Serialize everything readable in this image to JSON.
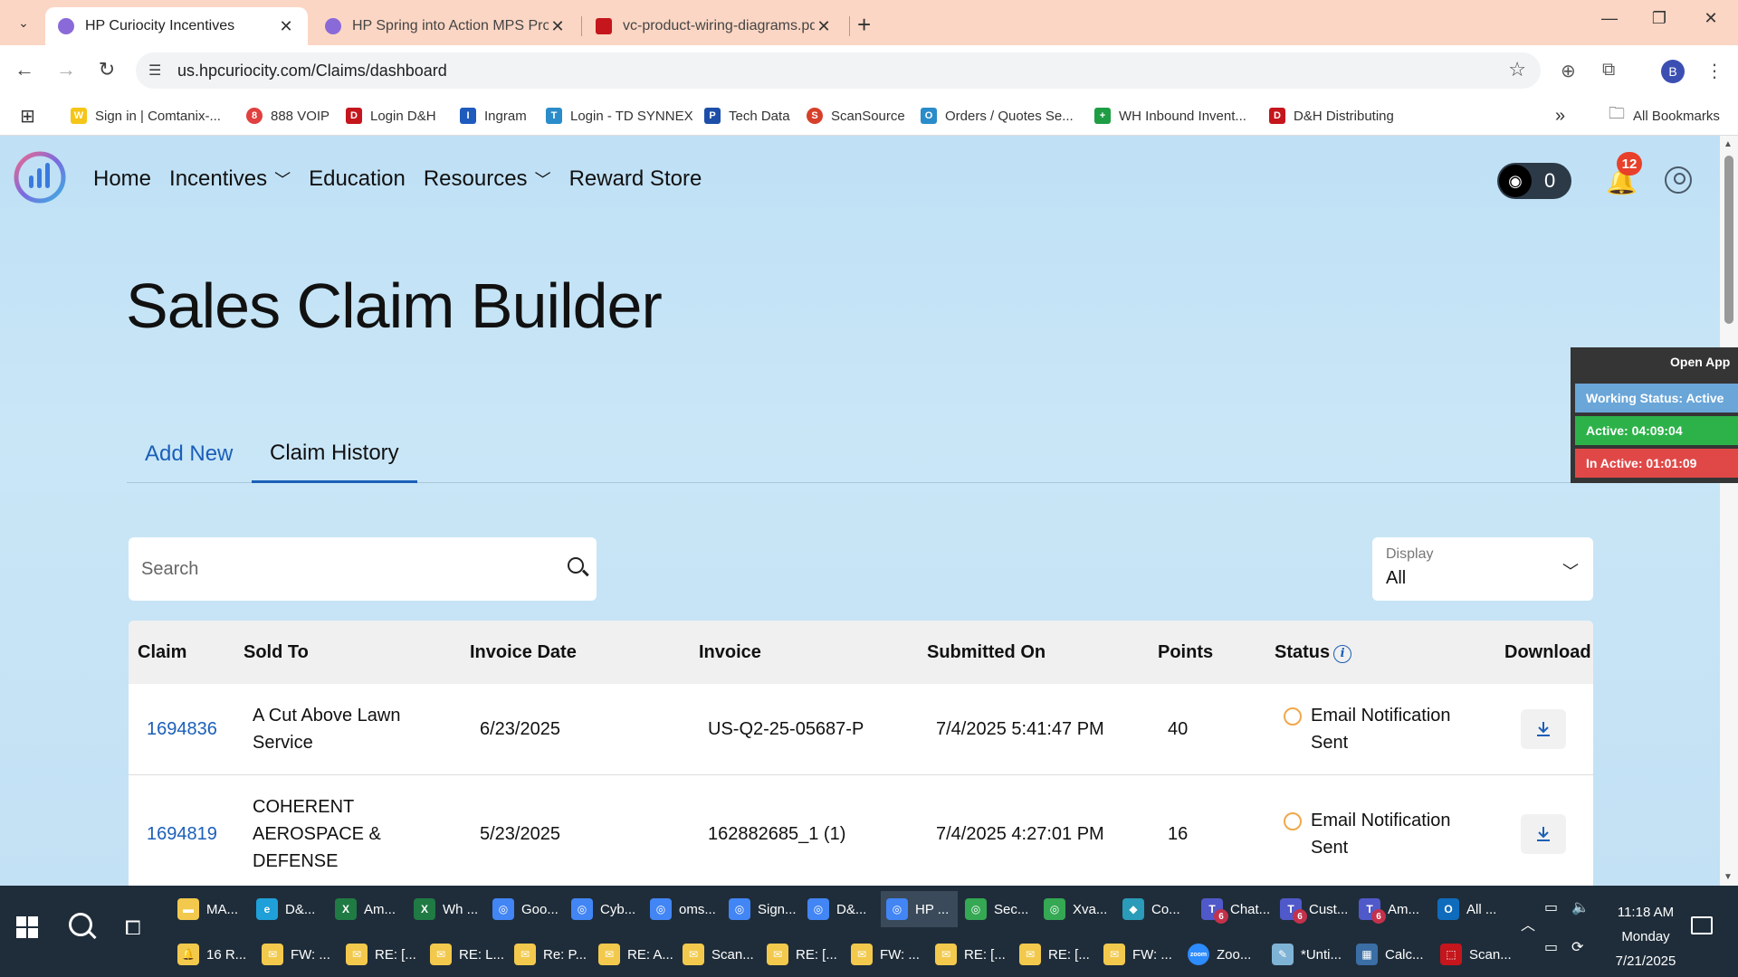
{
  "browser": {
    "tabs": [
      {
        "title": "HP Curiocity Incentives",
        "active": true,
        "favicon_color": "#8a6ad8"
      },
      {
        "title": "HP Spring into Action MPS Pro",
        "active": false,
        "favicon_color": "#8a6ad8"
      },
      {
        "title": "vc-product-wiring-diagrams.pd",
        "active": false,
        "favicon_color": "#c4161c"
      }
    ],
    "url": "us.hpcuriocity.com/Claims/dashboard",
    "profile_initial": "B"
  },
  "bookmarks": [
    {
      "label": "Sign in | Comtanix-...",
      "icon_color": "#f5c518",
      "icon_text": "W"
    },
    {
      "label": "888 VOIP",
      "icon_color": "#e04040",
      "icon_text": "8"
    },
    {
      "label": "Login D&H",
      "icon_color": "#c4161c",
      "icon_text": "D"
    },
    {
      "label": "Ingram",
      "icon_color": "#1e5bbd",
      "icon_text": "I"
    },
    {
      "label": "Login - TD SYNNEX",
      "icon_color": "#2a8cc9",
      "icon_text": "T"
    },
    {
      "label": "Tech Data",
      "icon_color": "#1d4fa8",
      "icon_text": "P"
    },
    {
      "label": "ScanSource",
      "icon_color": "#d6402a",
      "icon_text": "S"
    },
    {
      "label": "Orders / Quotes Se...",
      "icon_color": "#2a8cc9",
      "icon_text": "O"
    },
    {
      "label": "WH Inbound Invent...",
      "icon_color": "#1f9d44",
      "icon_text": "+"
    },
    {
      "label": "D&H Distributing",
      "icon_color": "#c4161c",
      "icon_text": "D"
    }
  ],
  "bookmarks_all": "All Bookmarks",
  "nav": {
    "items": [
      "Home",
      "Incentives",
      "Education",
      "Resources",
      "Reward Store"
    ],
    "points": "0",
    "notifications": "12"
  },
  "page": {
    "title": "Sales Claim Builder",
    "tabs": [
      "Add New",
      "Claim History"
    ],
    "active_tab": "Claim History"
  },
  "search": {
    "placeholder": "Search"
  },
  "display": {
    "label": "Display",
    "value": "All"
  },
  "table": {
    "headers": [
      "Claim",
      "Sold To",
      "Invoice Date",
      "Invoice",
      "Submitted On",
      "Points",
      "Status",
      "Download"
    ],
    "rows": [
      {
        "claim": "1694836",
        "sold_to_lines": [
          "A Cut Above Lawn",
          "Service"
        ],
        "invoice_date": "6/23/2025",
        "invoice": "US-Q2-25-05687-P",
        "submitted_on": "7/4/2025 5:41:47 PM",
        "points": "40",
        "status_lines": [
          "Email Notification",
          "Sent"
        ]
      },
      {
        "claim": "1694819",
        "sold_to_lines": [
          "COHERENT",
          "AEROSPACE &",
          "DEFENSE"
        ],
        "invoice_date": "5/23/2025",
        "invoice": "162882685_1 (1)",
        "submitted_on": "7/4/2025 4:27:01 PM",
        "points": "16",
        "status_lines": [
          "Email Notification",
          "Sent"
        ]
      }
    ]
  },
  "work_widget": {
    "open_app": "Open App",
    "status": "Working Status: Active",
    "active": "Active: 04:09:04",
    "inactive": "In Active: 01:01:09"
  },
  "taskbar": {
    "row1": [
      {
        "label": "MA...",
        "icon": "folder",
        "color": "#f2c94c"
      },
      {
        "label": "D&...",
        "icon": "edge",
        "color": "#1fa0d8"
      },
      {
        "label": "Am...",
        "icon": "excel",
        "color": "#1f7a44"
      },
      {
        "label": "Wh ...",
        "icon": "excel",
        "color": "#1f7a44"
      },
      {
        "label": "Goo...",
        "icon": "chrome",
        "color": "#4285f4"
      },
      {
        "label": "Cyb...",
        "icon": "chrome",
        "color": "#4285f4"
      },
      {
        "label": "oms...",
        "icon": "chrome",
        "color": "#4285f4"
      },
      {
        "label": "Sign...",
        "icon": "chrome",
        "color": "#4285f4"
      },
      {
        "label": "D&...",
        "icon": "chrome",
        "color": "#4285f4"
      },
      {
        "label": "HP ...",
        "icon": "chrome",
        "color": "#4285f4"
      },
      {
        "label": "Sec...",
        "icon": "chrome",
        "color": "#34a853"
      },
      {
        "label": "Xva...",
        "icon": "chrome",
        "color": "#34a853"
      },
      {
        "label": "Co...",
        "icon": "app",
        "color": "#2a9bb8"
      },
      {
        "label": "Chat...",
        "icon": "teams",
        "color": "#5059c9",
        "badge": "6"
      },
      {
        "label": "Cust...",
        "icon": "teams",
        "color": "#5059c9",
        "badge": "6"
      },
      {
        "label": "Am...",
        "icon": "teams",
        "color": "#5059c9",
        "badge": "6"
      },
      {
        "label": "All ...",
        "icon": "outlook",
        "color": "#0f6cbd"
      }
    ],
    "row2": [
      {
        "label": "16 R...",
        "icon": "bell",
        "color": "#f2c94c"
      },
      {
        "label": "FW: ...",
        "icon": "mail",
        "color": "#f2c94c"
      },
      {
        "label": "RE: [...",
        "icon": "mail",
        "color": "#f2c94c"
      },
      {
        "label": "RE: L...",
        "icon": "mail",
        "color": "#f2c94c"
      },
      {
        "label": "Re: P...",
        "icon": "mail",
        "color": "#f2c94c"
      },
      {
        "label": "RE: A...",
        "icon": "mail",
        "color": "#f2c94c"
      },
      {
        "label": "Scan...",
        "icon": "mail",
        "color": "#f2c94c"
      },
      {
        "label": "RE: [...",
        "icon": "mail",
        "color": "#f2c94c"
      },
      {
        "label": "FW: ...",
        "icon": "mail",
        "color": "#f2c94c"
      },
      {
        "label": "RE: [...",
        "icon": "mail",
        "color": "#f2c94c"
      },
      {
        "label": "RE: [...",
        "icon": "mail",
        "color": "#f2c94c"
      },
      {
        "label": "FW: ...",
        "icon": "mail",
        "color": "#f2c94c"
      },
      {
        "label": "Zoo...",
        "icon": "zoom",
        "color": "#2d8cff"
      },
      {
        "label": "*Unti...",
        "icon": "notepad",
        "color": "#7fb3d5"
      },
      {
        "label": "Calc...",
        "icon": "calc",
        "color": "#3a6ea5"
      },
      {
        "label": "Scan...",
        "icon": "pdf",
        "color": "#c4161c"
      }
    ],
    "clock": {
      "time": "11:18 AM",
      "day": "Monday",
      "date": "7/21/2025"
    }
  }
}
